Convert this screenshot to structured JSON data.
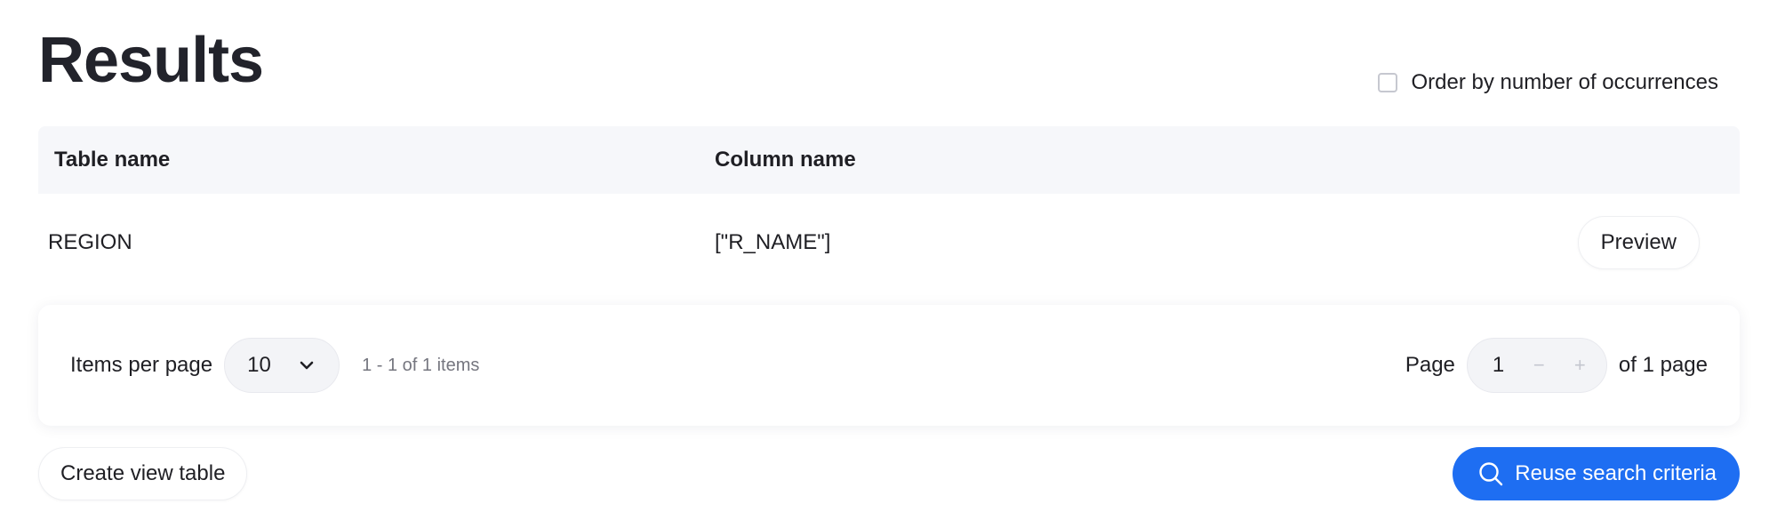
{
  "header": {
    "title": "Results",
    "order_label": "Order by number of occurrences"
  },
  "table": {
    "columns": [
      "Table name",
      "Column name"
    ],
    "rows": [
      {
        "table_name": "REGION",
        "column_name": "[\"R_NAME\"]",
        "action": "Preview"
      }
    ]
  },
  "pagination": {
    "items_per_page_label": "Items per page",
    "items_per_page_value": "10",
    "range_text": "1 - 1 of 1 items",
    "page_label": "Page",
    "current_page": "1",
    "minus": "−",
    "plus": "+",
    "of_pages": "of 1 page"
  },
  "footer": {
    "create_label": "Create view table",
    "reuse_label": "Reuse search criteria"
  },
  "colors": {
    "primary": "#1e6ef2",
    "header_bg": "#f6f7fa"
  },
  "icons": {
    "dropdown": "chevron-down-icon",
    "search": "search-icon"
  }
}
